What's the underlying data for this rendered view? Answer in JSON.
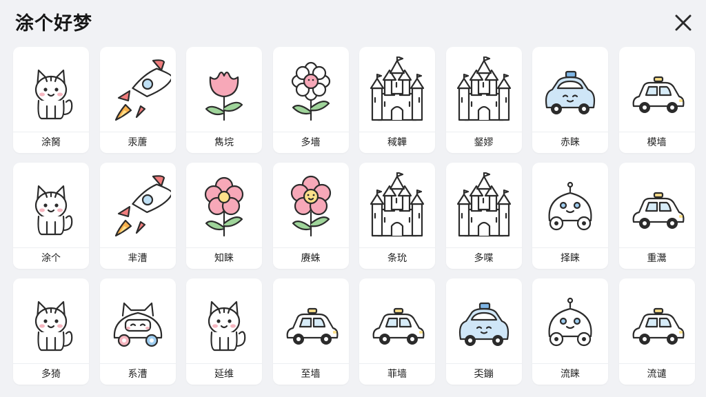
{
  "header": {
    "title": "涂个好梦",
    "close_icon": "close-icon"
  },
  "colors": {
    "background": "#f1f2f5",
    "card": "#ffffff"
  },
  "cards": [
    {
      "icon": "cat-icon",
      "label": "涂胬"
    },
    {
      "icon": "rocket-icon",
      "label": "汞蓎"
    },
    {
      "icon": "tulip-icon",
      "label": "雋垸"
    },
    {
      "icon": "daisy-icon",
      "label": "多墻"
    },
    {
      "icon": "castle-icon",
      "label": "稢韡"
    },
    {
      "icon": "castle-icon",
      "label": "錖嫪"
    },
    {
      "icon": "car-face-icon",
      "label": "赤睐"
    },
    {
      "icon": "car-icon",
      "label": "模墙"
    },
    {
      "icon": "cat-icon",
      "label": "涂个"
    },
    {
      "icon": "rocket-icon",
      "label": "芈漕"
    },
    {
      "icon": "flower-icon",
      "label": "知睐"
    },
    {
      "icon": "flower-face-icon",
      "label": "赓蛛"
    },
    {
      "icon": "castle-icon",
      "label": "条玧"
    },
    {
      "icon": "castle-icon",
      "label": "多喋"
    },
    {
      "icon": "robot-car-icon",
      "label": "择睐"
    },
    {
      "icon": "car-icon",
      "label": "重灊"
    },
    {
      "icon": "cat-icon",
      "label": "多猗"
    },
    {
      "icon": "cat-car-icon",
      "label": "系漕"
    },
    {
      "icon": "cat-icon",
      "label": "延维"
    },
    {
      "icon": "car-icon",
      "label": "至墙"
    },
    {
      "icon": "car-icon",
      "label": "菲墙"
    },
    {
      "icon": "car-face-icon",
      "label": "奀鏰"
    },
    {
      "icon": "robot-car-icon",
      "label": "流睐"
    },
    {
      "icon": "car-icon",
      "label": "流谴"
    }
  ]
}
